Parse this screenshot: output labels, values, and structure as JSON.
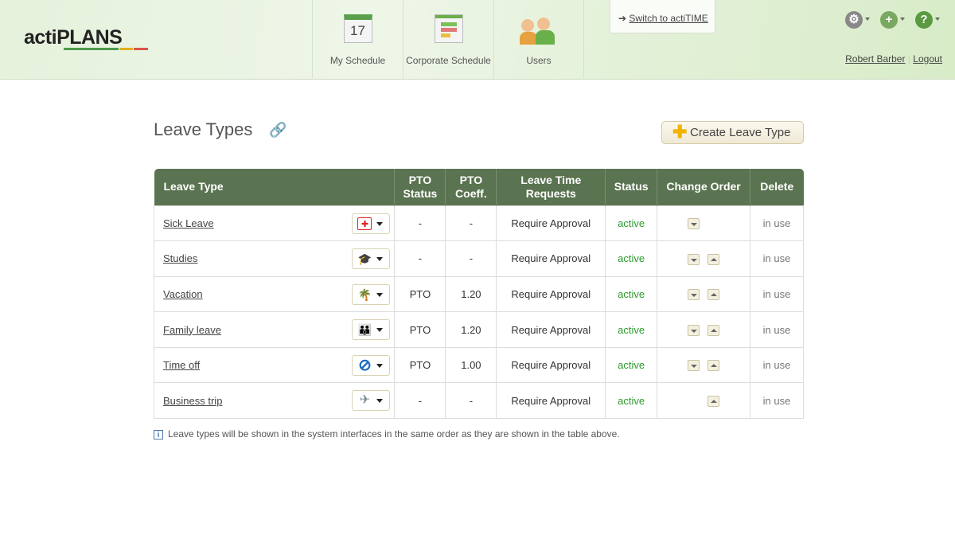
{
  "app": {
    "logo": "actiPLANS"
  },
  "nav": [
    {
      "label": "My Schedule",
      "icon": "calendar-17-icon",
      "day": "17"
    },
    {
      "label": "Corporate Schedule",
      "icon": "corporate-calendar-icon"
    },
    {
      "label": "Users",
      "icon": "users-icon"
    }
  ],
  "switch_label": "Switch to actiTIME",
  "user": {
    "name": "Robert Barber",
    "logout": "Logout"
  },
  "page": {
    "title": "Leave Types",
    "create_label": "Create Leave Type",
    "note": "Leave types will be shown in the system interfaces in the same order as they are shown in the table above."
  },
  "table": {
    "headers": [
      "Leave Type",
      "PTO Status",
      "PTO Coeff.",
      "Leave Time Requests",
      "Status",
      "Change Order",
      "Delete"
    ],
    "rows": [
      {
        "name": "Sick Leave",
        "icon": "medical-cross-icon",
        "pto": "-",
        "coeff": "-",
        "requests": "Require Approval",
        "status": "active",
        "down": true,
        "up": false,
        "delete": "in use"
      },
      {
        "name": "Studies",
        "icon": "graduation-cap-icon",
        "pto": "-",
        "coeff": "-",
        "requests": "Require Approval",
        "status": "active",
        "down": true,
        "up": true,
        "delete": "in use"
      },
      {
        "name": "Vacation",
        "icon": "palm-tree-icon",
        "pto": "PTO",
        "coeff": "1.20",
        "requests": "Require Approval",
        "status": "active",
        "down": true,
        "up": true,
        "delete": "in use"
      },
      {
        "name": "Family leave",
        "icon": "family-icon",
        "pto": "PTO",
        "coeff": "1.20",
        "requests": "Require Approval",
        "status": "active",
        "down": true,
        "up": true,
        "delete": "in use"
      },
      {
        "name": "Time off",
        "icon": "prohibited-icon",
        "pto": "PTO",
        "coeff": "1.00",
        "requests": "Require Approval",
        "status": "active",
        "down": true,
        "up": true,
        "delete": "in use"
      },
      {
        "name": "Business trip",
        "icon": "airplane-icon",
        "pto": "-",
        "coeff": "-",
        "requests": "Require Approval",
        "status": "active",
        "down": false,
        "up": true,
        "delete": "in use"
      }
    ]
  }
}
